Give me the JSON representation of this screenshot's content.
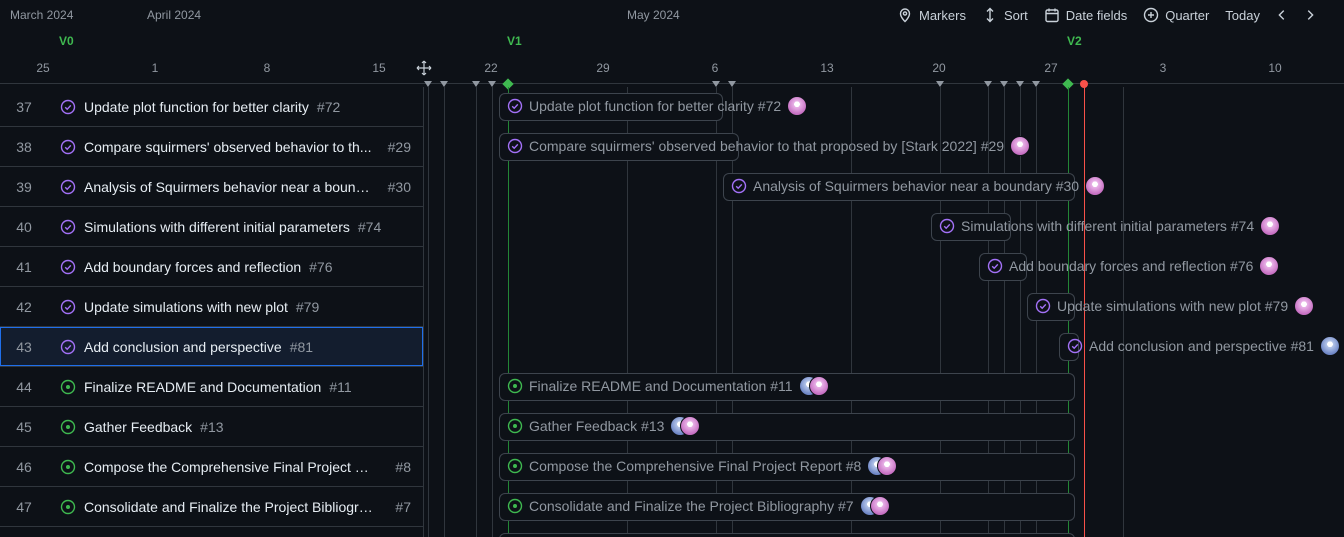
{
  "header": {
    "months": [
      {
        "label": "March 2024"
      },
      {
        "label": "April 2024"
      },
      {
        "label": "May 2024"
      }
    ],
    "toolbar": {
      "markers": "Markers",
      "sort": "Sort",
      "date_fields": "Date fields",
      "zoom": "Quarter",
      "today": "Today"
    },
    "milestones": [
      "V0",
      "V1",
      "V2"
    ],
    "days": [
      "25",
      "1",
      "8",
      "15",
      "22",
      "29",
      "6",
      "13",
      "20",
      "27",
      "3",
      "10"
    ]
  },
  "colors": {
    "background": "#0d1117",
    "border": "#30363d",
    "closed_purple": "#a371f7",
    "open_green": "#3fb950",
    "today_red": "#f85149",
    "selected_blue": "#1f6feb"
  },
  "rows": [
    {
      "num": "37",
      "title": "Update plot function for better clarity",
      "ref": "#72",
      "state": "closed",
      "bar_label": "Update plot function for better clarity #72",
      "assignees": [
        "pink"
      ]
    },
    {
      "num": "38",
      "title": "Compare squirmers' observed behavior to th...",
      "ref": "#29",
      "state": "closed",
      "bar_label": "Compare squirmers' observed behavior to that proposed by [Stark 2022] #29",
      "assignees": [
        "pink"
      ]
    },
    {
      "num": "39",
      "title": "Analysis of Squirmers behavior near a bound...",
      "ref": "#30",
      "state": "closed",
      "bar_label": "Analysis of Squirmers behavior near a boundary #30",
      "assignees": [
        "pink"
      ]
    },
    {
      "num": "40",
      "title": "Simulations with different initial parameters",
      "ref": "#74",
      "state": "closed",
      "bar_label": "Simulations with different initial parameters #74",
      "assignees": [
        "pink"
      ]
    },
    {
      "num": "41",
      "title": "Add boundary forces and reflection",
      "ref": "#76",
      "state": "closed",
      "bar_label": "Add boundary forces and reflection #76",
      "assignees": [
        "pink"
      ]
    },
    {
      "num": "42",
      "title": "Update simulations with new plot",
      "ref": "#79",
      "state": "closed",
      "bar_label": "Update simulations with new plot #79",
      "assignees": [
        "pink"
      ]
    },
    {
      "num": "43",
      "title": "Add conclusion and perspective",
      "ref": "#81",
      "state": "closed",
      "bar_label": "Add conclusion and perspective #81",
      "assignees": [
        "blue"
      ],
      "selected": true
    },
    {
      "num": "44",
      "title": "Finalize README and Documentation",
      "ref": "#11",
      "state": "open",
      "bar_label": "Finalize README and Documentation #11",
      "assignees": [
        "blue",
        "pink"
      ]
    },
    {
      "num": "45",
      "title": "Gather Feedback",
      "ref": "#13",
      "state": "open",
      "bar_label": "Gather Feedback #13",
      "assignees": [
        "blue",
        "pink"
      ]
    },
    {
      "num": "46",
      "title": "Compose the Comprehensive Final Project Re...",
      "ref": "#8",
      "state": "open",
      "bar_label": "Compose the Comprehensive Final Project Report #8",
      "assignees": [
        "blue",
        "pink"
      ]
    },
    {
      "num": "47",
      "title": "Consolidate and Finalize the Project Bibliograp...",
      "ref": "#7",
      "state": "open",
      "bar_label": "Consolidate and Finalize the Project Bibliography #7",
      "assignees": [
        "blue",
        "pink"
      ]
    }
  ]
}
